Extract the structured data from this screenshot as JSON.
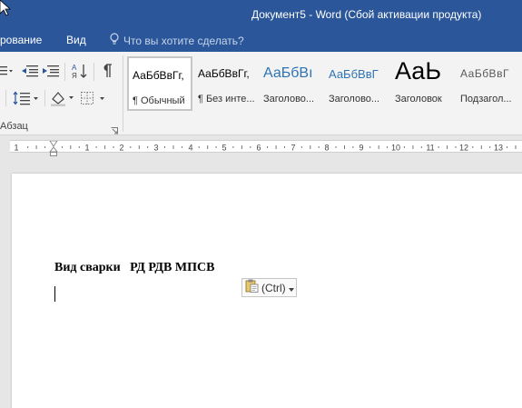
{
  "window": {
    "title": "Документ5 - Word (Сбой активации продукта)"
  },
  "tabs": [
    {
      "label": "рование"
    },
    {
      "label": "Вид"
    }
  ],
  "tell_me": {
    "placeholder": "Что вы хотите сделать?"
  },
  "ribbon": {
    "paragraph_group_label": "Абзац",
    "styles": [
      {
        "preview": "АаБбВвГг,",
        "name": "¶ Обычный",
        "selected": true
      },
      {
        "preview": "АаБбВвГг,",
        "name": "¶ Без инте..."
      },
      {
        "preview": "АаБбВı",
        "name": "Заголово..."
      },
      {
        "preview": "АаБбВвГ",
        "name": "Заголово..."
      },
      {
        "preview": "АаЬ",
        "name": "Заголовок"
      },
      {
        "preview": "АаБбВвГ",
        "name": "Подзагол..."
      }
    ]
  },
  "ruler": {
    "numbers": [
      "1",
      "1",
      "2",
      "3",
      "4",
      "5",
      "6",
      "7",
      "8",
      "9",
      "10",
      "11",
      "12",
      "13"
    ]
  },
  "document": {
    "line1": "Вид сварки   РД РДВ МПСВ"
  },
  "paste_options": {
    "label": "(Ctrl)"
  },
  "colors": {
    "accent": "#2b579a",
    "ribbon_bg": "#f3f3f3",
    "canvas_bg": "#e6e6e6"
  },
  "icons": [
    "mouse-pointer-icon",
    "lightbulb-icon",
    "list-icon",
    "decrease-indent-icon",
    "increase-indent-icon",
    "sort-icon",
    "pilcrow-icon",
    "line-spacing-icon",
    "shading-icon",
    "borders-icon",
    "dialog-launcher-icon",
    "paste-clipboard-icon",
    "dropdown-arrow-icon"
  ]
}
